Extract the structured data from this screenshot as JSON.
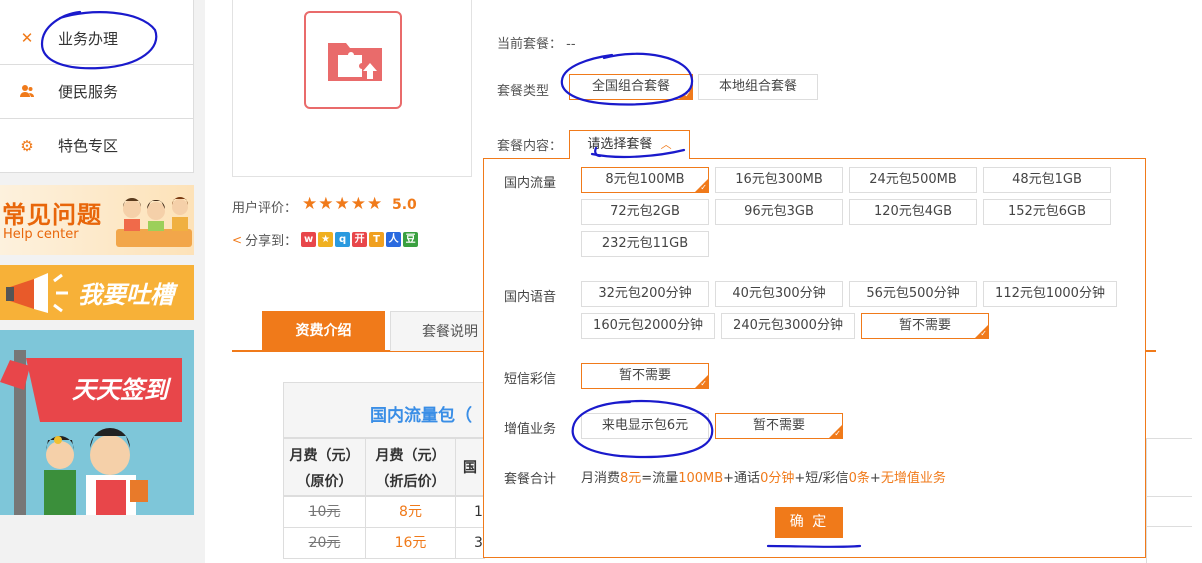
{
  "sidebar": {
    "items": [
      {
        "label": "业务办理",
        "icon": "tools-icon"
      },
      {
        "label": "便民服务",
        "icon": "people-icon"
      },
      {
        "label": "特色专区",
        "icon": "gear-icon"
      }
    ]
  },
  "banners": {
    "faq_title": "常见问题",
    "faq_sub": "Help center",
    "complain": "我要吐槽",
    "sign": "天天签到"
  },
  "product": {
    "rating_label": "用户评价：",
    "stars": "★★★★★",
    "score": "5.0",
    "share_label": "分享到："
  },
  "plan": {
    "current_label": "当前套餐：",
    "current_value": "--",
    "type_label": "套餐类型",
    "types": [
      "全国组合套餐",
      "本地组合套餐"
    ],
    "content_label": "套餐内容：",
    "select_label": "请选择套餐",
    "select_arrow": "^"
  },
  "panel": {
    "data_label": "国内流量",
    "data_options": [
      "8元包100MB",
      "16元包300MB",
      "24元包500MB",
      "48元包1GB",
      "72元包2GB",
      "96元包3GB",
      "120元包4GB",
      "152元包6GB",
      "232元包11GB"
    ],
    "voice_label": "国内语音",
    "voice_options": [
      "32元包200分钟",
      "40元包300分钟",
      "56元包500分钟",
      "112元包1000分钟",
      "160元包2000分钟",
      "240元包3000分钟",
      "暂不需要"
    ],
    "sms_label": "短信彩信",
    "sms_option": "暂不需要",
    "vas_label": "增值业务",
    "vas_options": [
      "来电显示包6元",
      "暂不需要"
    ],
    "total_label": "套餐合计",
    "total_parts": {
      "p1": "月消费",
      "p2": "8元",
      "p3": "=流量",
      "p4": "100MB",
      "p5": "+通话",
      "p6": "0分钟",
      "p7": "+短/彩信",
      "p8": "0条",
      "p9": "+",
      "p10": "无增值业务"
    },
    "confirm": "确 定"
  },
  "tabs": [
    "资费介绍",
    "套餐说明"
  ],
  "table": {
    "title": "国内流量包（",
    "headers": [
      "月费（元）（原价）",
      "月费（元）（折后价）",
      "国"
    ],
    "h1a": "月费（元）",
    "h1b": "（原价）",
    "h2a": "月费（元）",
    "h2b": "（折后价）",
    "h3": "国",
    "rows": [
      {
        "orig": "10元",
        "disc": "8元",
        "c3": "1"
      },
      {
        "orig": "20元",
        "disc": "16元",
        "c3": "3"
      }
    ]
  },
  "colors": {
    "accent": "#f07a1a",
    "blue_title": "#3a8ee6",
    "annotation": "#1a1acc"
  }
}
